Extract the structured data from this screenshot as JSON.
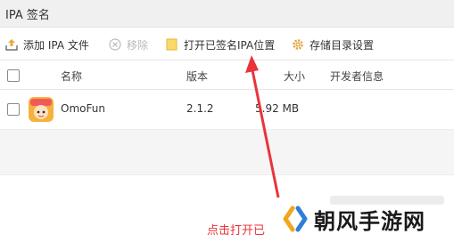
{
  "window": {
    "title": "IPA 签名"
  },
  "toolbar": {
    "add": "添加 IPA 文件",
    "remove": "移除",
    "open_location": "打开已签名IPA位置",
    "storage_settings": "存储目录设置"
  },
  "table": {
    "columns": {
      "name": "名称",
      "version": "版本",
      "size": "大小",
      "developer": "开发者信息"
    },
    "rows": [
      {
        "name": "OmoFun",
        "version": "2.1.2",
        "size": "5.92 MB",
        "developer": ""
      }
    ]
  },
  "annotation": {
    "text": "点击打开已"
  },
  "watermark": {
    "text": "朝风手游网"
  },
  "colors": {
    "arrow": "#e8343a",
    "annotation_text": "#e8343a"
  }
}
